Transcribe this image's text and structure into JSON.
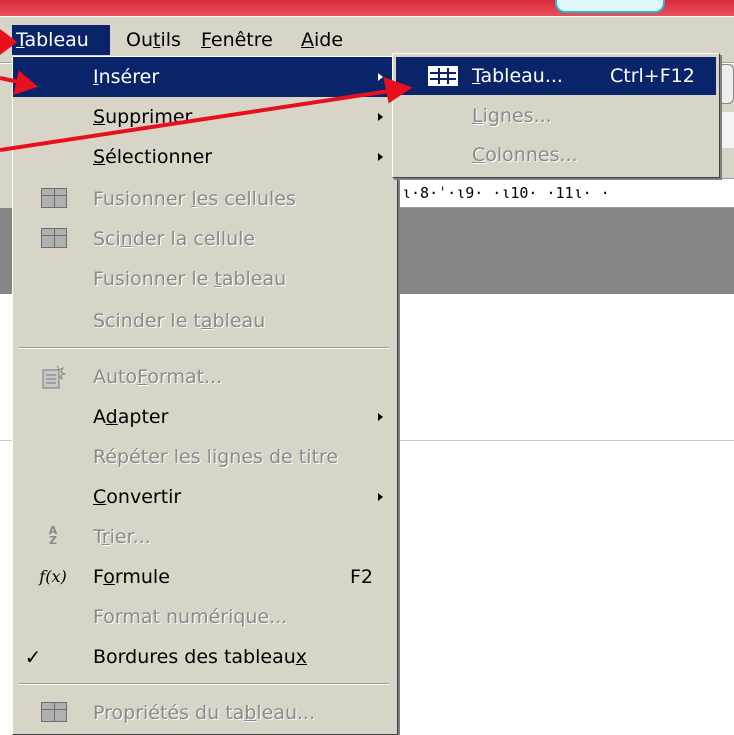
{
  "menubar": {
    "items": [
      {
        "label_u": "T",
        "label_rest": "ableau"
      },
      {
        "label_pre": "Ou",
        "label_u": "t",
        "label_rest": "ils"
      },
      {
        "label_u": "F",
        "label_rest": "enêtre"
      },
      {
        "label_u": "A",
        "label_rest": "ide"
      }
    ]
  },
  "ruler": {
    "text": "ι·8·ˈ·ι9· ·ι10· ·11ι· ·"
  },
  "main_menu": {
    "insert": {
      "pre": "",
      "u": "I",
      "rest": "nsérer"
    },
    "delete": {
      "pre": "",
      "u": "S",
      "rest": "upprimer"
    },
    "select": {
      "pre": "",
      "u": "S",
      "rest": "électionner"
    },
    "merge_cells": {
      "pre": "Fusionner ",
      "u": "l",
      "rest": "es cellules"
    },
    "split_cell": {
      "pre": "Sci",
      "u": "n",
      "rest": "der la cellule"
    },
    "merge_table": {
      "pre": "Fusionner le ",
      "u": "t",
      "rest": "ableau"
    },
    "split_table": {
      "pre": "Scinder le t",
      "u": "a",
      "rest": "bleau"
    },
    "autoformat": {
      "pre": "Auto",
      "u": "F",
      "rest": "ormat..."
    },
    "adapt": {
      "pre": "A",
      "u": "d",
      "rest": "apter"
    },
    "repeat_titles": {
      "label": "Répéter les lignes de titre"
    },
    "convert": {
      "pre": "",
      "u": "C",
      "rest": "onvertir"
    },
    "sort": {
      "pre": "T",
      "u": "r",
      "rest": "ier..."
    },
    "formula": {
      "pre": "F",
      "u": "o",
      "rest": "rmule",
      "shortcut": "F2"
    },
    "number_format": {
      "label": "Format numérique..."
    },
    "table_borders": {
      "pre": "Bordures des tableau",
      "u": "x",
      "rest": ""
    },
    "table_props": {
      "pre": "Propriétés du ta",
      "u": "b",
      "rest": "leau..."
    }
  },
  "submenu": {
    "table": {
      "pre": "",
      "u": "T",
      "rest": "ableau...",
      "shortcut": "Ctrl+F12"
    },
    "rows": {
      "pre": "",
      "u": "L",
      "rest": "ignes..."
    },
    "columns": {
      "pre": "",
      "u": "C",
      "rest": "olonnes..."
    }
  },
  "icons": {
    "check": "✓",
    "formula": "f(x)",
    "sort_top": "A",
    "sort_bottom": "Z"
  },
  "colors": {
    "highlight": "#0a246a",
    "menu_bg": "#d8d4c8",
    "annotation_red": "#e8101e",
    "disabled_text": "#8a8a8a"
  }
}
